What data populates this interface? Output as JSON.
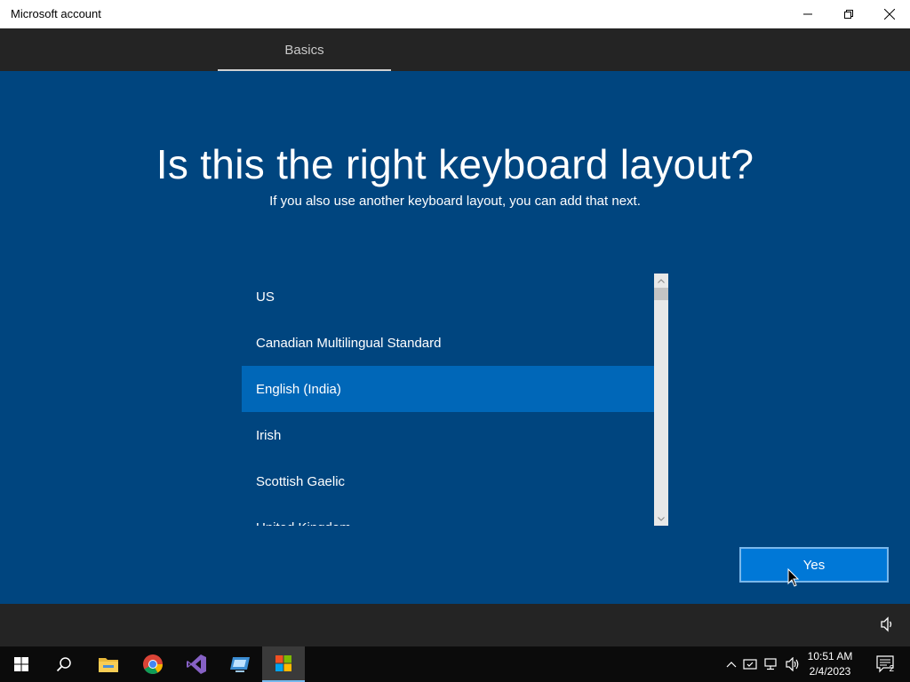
{
  "window": {
    "title": "Microsoft account",
    "controls": [
      "minimize-icon",
      "restore-icon",
      "close-icon"
    ]
  },
  "tabs": [
    {
      "label": "Basics",
      "active": true
    }
  ],
  "main": {
    "heading": "Is this the right keyboard layout?",
    "subheading": "If you also use another keyboard layout, you can add that next.",
    "layouts": [
      {
        "label": "US",
        "selected": false
      },
      {
        "label": "Canadian Multilingual Standard",
        "selected": false
      },
      {
        "label": "English (India)",
        "selected": true
      },
      {
        "label": "Irish",
        "selected": false
      },
      {
        "label": "Scottish Gaelic",
        "selected": false
      },
      {
        "label": "United Kingdom",
        "selected": false
      }
    ],
    "yes_label": "Yes"
  },
  "taskbar": {
    "apps": [
      "start-icon",
      "search-icon",
      "file-explorer-icon",
      "chrome-icon",
      "visual-studio-icon",
      "remote-desktop-icon",
      "store-icon"
    ],
    "time": "10:51 AM",
    "date": "2/4/2023",
    "notification_count": "2"
  },
  "colors": {
    "background": "#00457f",
    "selected": "#0067b8",
    "button": "#0078d7",
    "header": "#242424"
  }
}
